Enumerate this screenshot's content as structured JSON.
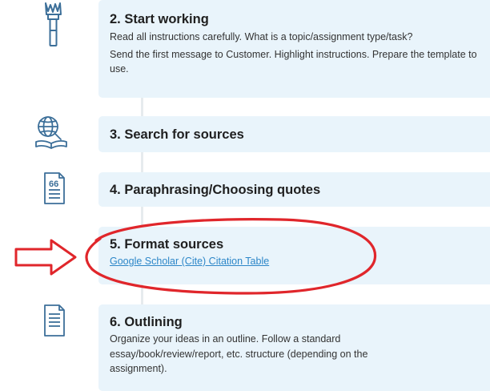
{
  "steps": [
    {
      "title": "2. Start working",
      "lines": [
        "Read all instructions carefully. What is a topic/assignment type/task?",
        "Send the first message to Customer. Highlight instructions. Prepare the template to use."
      ],
      "icon": "paintbrush-icon"
    },
    {
      "title": "3. Search for sources",
      "icon": "globe-search-icon"
    },
    {
      "title": "4. Paraphrasing/Choosing quotes",
      "icon": "quote-document-icon"
    },
    {
      "title": "5. Format sources",
      "link": "Google Scholar (Cite) Citation Table",
      "icon": "document-icon"
    },
    {
      "title": "6. Outlining",
      "lines": [
        "Organize your ideas in an outline. Follow a standard essay/book/review/report, etc. structure (depending on the assignment)."
      ],
      "icon": "outline-document-icon"
    }
  ],
  "annotations": {
    "arrow_color": "#e0262b",
    "circle_color": "#e0262b"
  },
  "colors": {
    "card_background": "#e9f4fb",
    "icon_blue": "#3c6f99",
    "link_blue": "#2c86c8"
  }
}
